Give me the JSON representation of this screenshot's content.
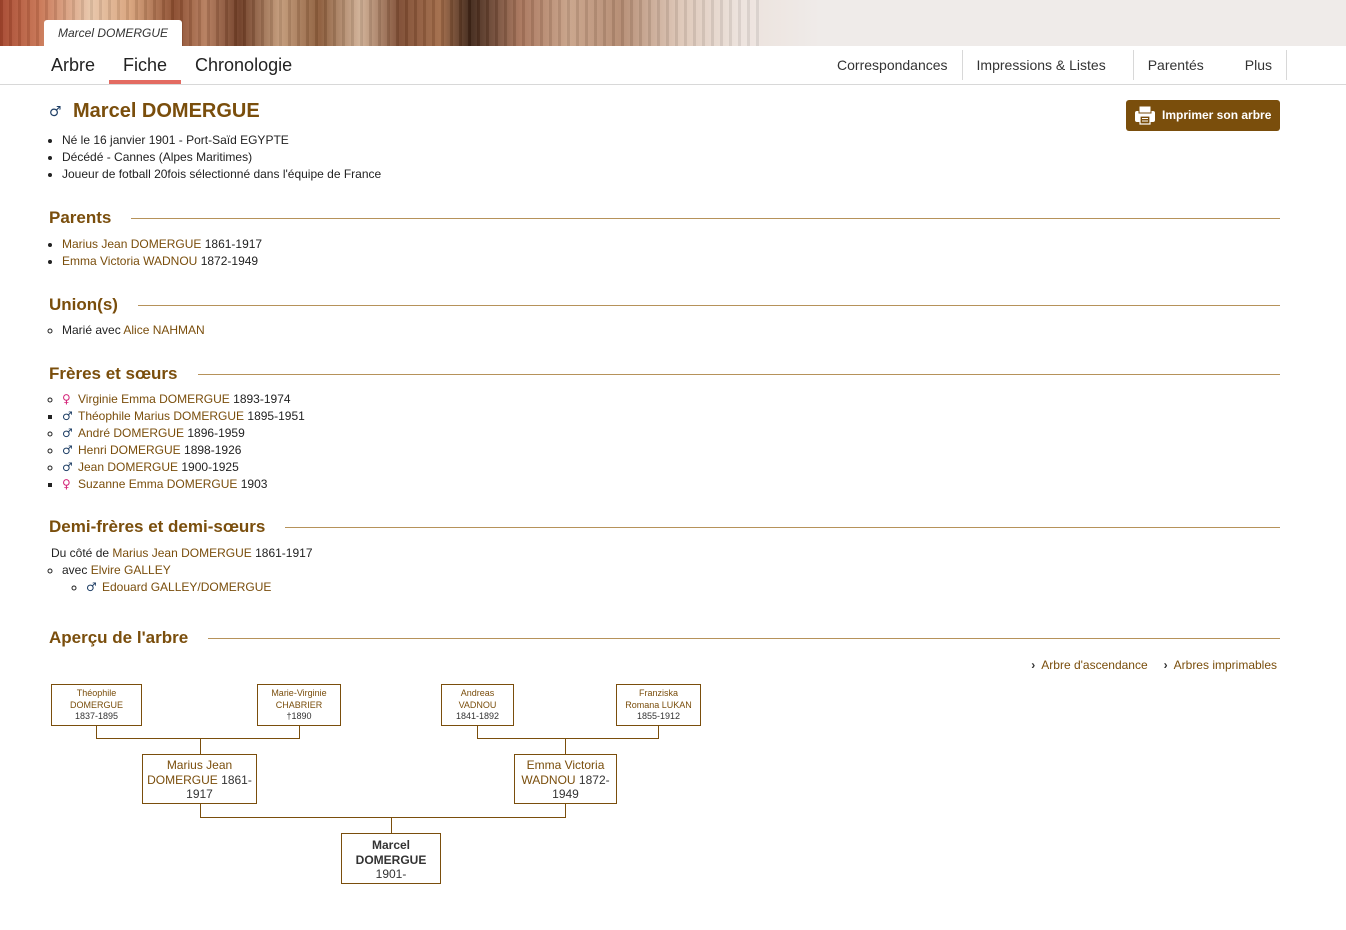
{
  "person_tab": "Marcel DOMERGUE",
  "nav": {
    "tabs": [
      {
        "label": "Arbre"
      },
      {
        "label": "Fiche"
      },
      {
        "label": "Chronologie"
      }
    ],
    "menu": [
      {
        "label": "Correspondances"
      },
      {
        "label": "Impressions & Listes"
      },
      {
        "label": "Parentés"
      },
      {
        "label": "Plus"
      }
    ]
  },
  "person": {
    "name": "Marcel DOMERGUE",
    "gender_symbol": "♂",
    "print_label": "Imprimer son arbre",
    "facts": [
      "Né le 16 janvier 1901 - Port-Saïd EGYPTE",
      "Décédé - Cannes (Alpes Maritimes)",
      "Joueur de fotball 20fois sélectionné dans l'équipe de France"
    ]
  },
  "parents": {
    "title": "Parents",
    "items": [
      {
        "name": "Marius Jean DOMERGUE",
        "years": "1861-1917"
      },
      {
        "name": "Emma Victoria WADNOU",
        "years": "1872-1949"
      }
    ]
  },
  "unions": {
    "title": "Union(s)",
    "prefix": "Marié avec",
    "spouse": "Alice NAHMAN"
  },
  "siblings": {
    "title": "Frères et sœurs",
    "items": [
      {
        "symbol": "♀",
        "name": "Virginie Emma DOMERGUE",
        "years": "1893-1974"
      },
      {
        "symbol": "♂",
        "name": "Théophile Marius DOMERGUE",
        "years": "1895-1951"
      },
      {
        "symbol": "♂",
        "name": "André DOMERGUE",
        "years": "1896-1959"
      },
      {
        "symbol": "♂",
        "name": "Henri DOMERGUE",
        "years": "1898-1926"
      },
      {
        "symbol": "♂",
        "name": "Jean DOMERGUE",
        "years": "1900-1925"
      },
      {
        "symbol": "♀",
        "name": "Suzanne Emma DOMERGUE",
        "years": "1903"
      }
    ]
  },
  "half_siblings": {
    "title": "Demi-frères et demi-sœurs",
    "intro_prefix": "Du côté de",
    "parent_name": "Marius Jean DOMERGUE",
    "parent_years": "1861-1917",
    "with_prefix": "avec",
    "partner": "Elvire GALLEY",
    "child_symbol": "♂",
    "child": "Edouard GALLEY/DOMERGUE"
  },
  "tree": {
    "title": "Aperçu de l'arbre",
    "links": [
      {
        "label": "Arbre d'ascendance"
      },
      {
        "label": "Arbres imprimables"
      }
    ],
    "grandparents": [
      {
        "first": "Théophile",
        "last": "DOMERGUE",
        "years": "1837-1895"
      },
      {
        "first": "Marie-Virginie",
        "last": "CHABRIER",
        "years": "†1890"
      },
      {
        "first": "Andreas",
        "last": "VADNOU",
        "years": "1841-1892"
      },
      {
        "first": "Franziska",
        "last": "Romana LUKAN",
        "years": "1855-1912"
      }
    ],
    "parents": [
      {
        "first": "Marius Jean",
        "last": "DOMERGUE",
        "years_a": "1861-",
        "years_b": "1917"
      },
      {
        "first": "Emma Victoria",
        "last": "WADNOU",
        "years_a": "1872-",
        "years_b": "1949"
      }
    ],
    "root": {
      "first": "Marcel",
      "last": "DOMERGUE",
      "years": "1901-"
    }
  }
}
